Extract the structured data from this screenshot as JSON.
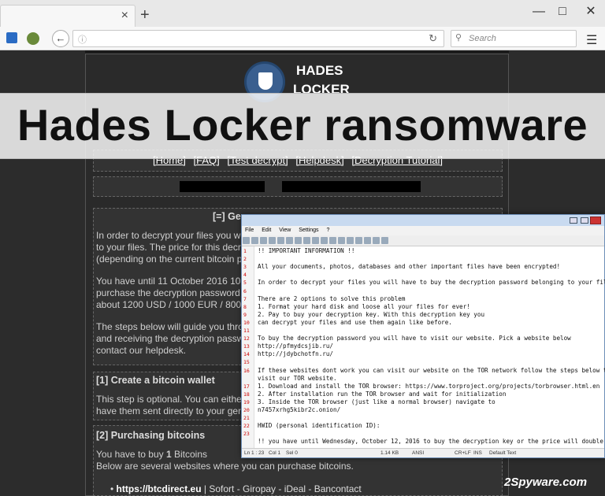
{
  "browser": {
    "search_placeholder": "Search",
    "new_tab": "+",
    "tab_close": "×"
  },
  "site": {
    "logo_line1": "HADES",
    "logo_line2": "LOCKER",
    "nav": [
      "[Home]",
      "[FAQ]",
      "[Test decrypt]",
      "[Helpdesk]",
      "[Decryption Tutorial]"
    ],
    "section_title": "[=] Ge",
    "intro": [
      "In order to decrypt your files you wi",
      "to your files. The price for this decr",
      "(depending on the current bitcoin p"
    ],
    "deadline": [
      "You have until 11 October 2016 10",
      "purchase the decryption password",
      "about 1200 USD / 1000 EUR / 800"
    ],
    "steps": [
      "The steps below will guide you thro",
      "and receiving the decryption passw",
      "contact our helpdesk."
    ],
    "step1_title": "[1] Create a bitcoin wallet",
    "step1_text": [
      "This step is optional. You can eithe",
      "have them sent directly to your gen"
    ],
    "step2_title": "[2] Purchasing bitcoins",
    "step2_buy_prefix": "You have to buy ",
    "step2_buy_amount": "1",
    "step2_buy_suffix": " Bitcoins",
    "step2_text": "Below are several websites where you can purchase bitcoins.",
    "site_link": "https://btcdirect.eu",
    "site_methods": " | Sofort - Giropay - iDeal - Bancontact"
  },
  "banner": {
    "text": "Hades Locker ransomware"
  },
  "notepad": {
    "menu": [
      "File",
      "Edit",
      "View",
      "Settings",
      "?"
    ],
    "lines": [
      "!! IMPORTANT INFORMATION !!",
      "",
      "All your documents, photos, databases and other important files have been encrypted!",
      "",
      "In order to decrypt your files you will have to buy the decryption password belonging to your fil",
      "",
      "There are 2 options to solve this problem",
      "1. Format your hard disk and loose all your files for ever!",
      "2. Pay to buy your decryption key. With this decryption key you",
      "   can decrypt your files and use them again like before.",
      "",
      "To buy the decryption password you will have to visit our website. Pick a website below",
      "http://pfmydcsjib.ru/",
      "http://jdybchotfn.ru/",
      "",
      "If these websites dont work you can visit our website on the TOR network follow the steps below t",
      "visit our TOR website.",
      "1. Download and install the TOR browser: https://www.torproject.org/projects/torbrowser.html.en",
      "2. After installation run the TOR browser and wait for initialization",
      "3. Inside the TOR browser (just like a normal browser) navigate to",
      "n7457xrhg5kibr2c.onion/",
      "",
      "HWID (personal identification ID):",
      "",
      "!! you have until Wednesday, October 12, 2016 to buy the decryption key or the price will double"
    ],
    "line_numbers": [
      "1",
      "2",
      "3",
      "4",
      "5",
      "6",
      "7",
      "8",
      "9",
      "10",
      "11",
      "12",
      "13",
      "14",
      "15",
      "16",
      "",
      "17",
      "18",
      "19",
      "20",
      "21",
      "22",
      "23",
      ""
    ],
    "status": {
      "pos": "Ln 1 : 23",
      "col": "Col 1",
      "sel": "Sel 0",
      "size": "1.14 KB",
      "enc": "ANSI",
      "eol": "CR+LF",
      "ins": "INS",
      "scheme": "Default Text"
    }
  },
  "watermark": "2Spyware.com"
}
